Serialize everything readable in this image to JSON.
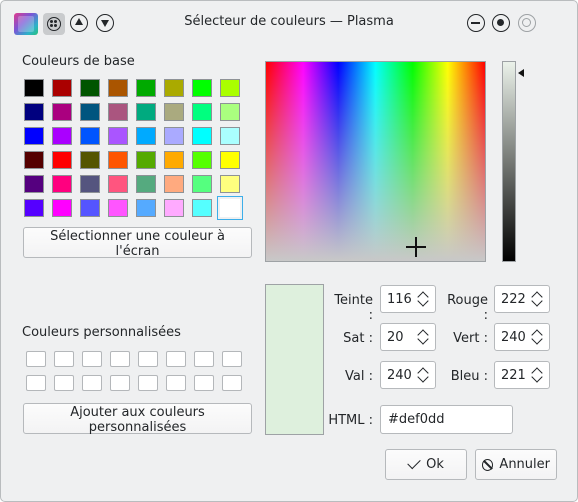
{
  "window": {
    "title": "Sélecteur de couleurs — Plasma"
  },
  "titlebar": {
    "icons": [
      "app-icon",
      "window-menu-icon",
      "keep-above-icon",
      "keep-below-icon",
      "minimize-icon",
      "maximize-icon",
      "close-icon"
    ]
  },
  "basic_colors": {
    "label": "Couleurs de base",
    "swatches": [
      "#000000",
      "#aa0000",
      "#005500",
      "#aa5500",
      "#00aa00",
      "#aaaa00",
      "#00ff00",
      "#aaff00",
      "#00007f",
      "#aa007f",
      "#00557f",
      "#aa557f",
      "#00aa7f",
      "#aaaa7f",
      "#00ff7f",
      "#aaff7f",
      "#0000ff",
      "#aa00ff",
      "#0055ff",
      "#aa55ff",
      "#00aaff",
      "#aaaaff",
      "#00ffff",
      "#aaffff",
      "#550000",
      "#ff0000",
      "#555500",
      "#ff5500",
      "#55aa00",
      "#ffaa00",
      "#55ff00",
      "#ffff00",
      "#55007f",
      "#ff007f",
      "#55557f",
      "#ff557f",
      "#55aa7f",
      "#ffaa7f",
      "#55ff7f",
      "#ffff7f",
      "#5500ff",
      "#ff00ff",
      "#5555ff",
      "#ff55ff",
      "#55aaff",
      "#ffaaff",
      "#55ffff",
      "#ffffff"
    ],
    "selected_index": 47
  },
  "pick_screen_button": "Sélectionner une couleur à l'écran",
  "custom_colors": {
    "label": "Couleurs personnalisées",
    "count": 16
  },
  "add_custom_button": "Ajouter aux couleurs personnalisées",
  "current_color": "#def0dd",
  "fields": {
    "hue": {
      "label": "Teinte :",
      "value": "116"
    },
    "sat": {
      "label": "Sat :",
      "value": "20"
    },
    "val": {
      "label": "Val :",
      "value": "240"
    },
    "red": {
      "label": "Rouge :",
      "value": "222"
    },
    "green": {
      "label": "Vert :",
      "value": "240"
    },
    "blue": {
      "label": "Bleu :",
      "value": "221"
    },
    "html": {
      "label": "HTML :",
      "value": "#def0dd"
    }
  },
  "buttons": {
    "ok": "Ok",
    "cancel": "Annuler"
  }
}
